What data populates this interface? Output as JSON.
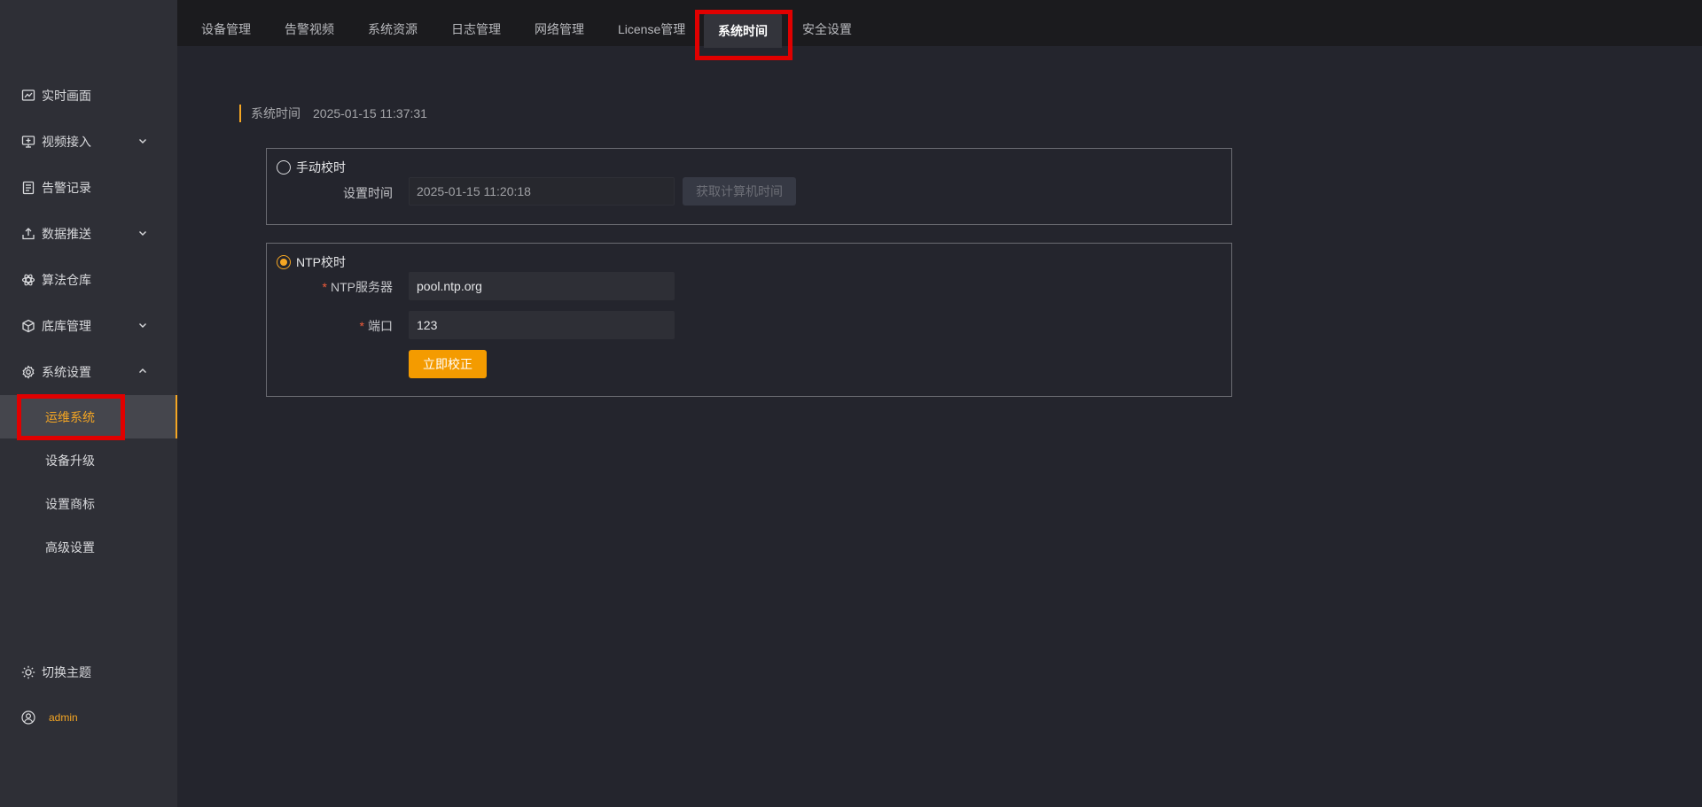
{
  "tabs": [
    {
      "label": "设备管理"
    },
    {
      "label": "告警视频"
    },
    {
      "label": "系统资源"
    },
    {
      "label": "日志管理"
    },
    {
      "label": "网络管理"
    },
    {
      "label": "License管理"
    },
    {
      "label": "系统时间"
    },
    {
      "label": "安全设置"
    }
  ],
  "sidebar": {
    "items": [
      {
        "label": "实时画面",
        "icon": "chart-line-icon"
      },
      {
        "label": "视频接入",
        "icon": "monitor-icon"
      },
      {
        "label": "告警记录",
        "icon": "document-icon"
      },
      {
        "label": "数据推送",
        "icon": "upload-icon"
      },
      {
        "label": "算法仓库",
        "icon": "atom-icon"
      },
      {
        "label": "底库管理",
        "icon": "cube-icon"
      },
      {
        "label": "系统设置",
        "icon": "gear-icon"
      }
    ],
    "submenu": [
      {
        "label": "运维系统",
        "active": true
      },
      {
        "label": "设备升级"
      },
      {
        "label": "设置商标"
      },
      {
        "label": "高级设置"
      }
    ],
    "theme_label": "切换主题",
    "user_name": "admin"
  },
  "main": {
    "header_label": "系统时间",
    "current_time": "2025-01-15 11:37:31",
    "manual": {
      "radio_label": "手动校时",
      "checked": false,
      "time_label": "设置时间",
      "time_value": "2025-01-15 11:20:18",
      "get_pc_time_label": "获取计算机时间"
    },
    "ntp": {
      "radio_label": "NTP校时",
      "checked": true,
      "server_label": "NTP服务器",
      "server_value": "pool.ntp.org",
      "port_label": "端口",
      "port_value": "123",
      "required_mark": "*",
      "apply_label": "立即校正"
    }
  },
  "colors": {
    "accent": "#f5a623",
    "highlight_box": "#e00000",
    "sidebar_bg": "#2e2f36",
    "content_bg": "#24252d",
    "topbar_bg": "#1b1b1e"
  }
}
